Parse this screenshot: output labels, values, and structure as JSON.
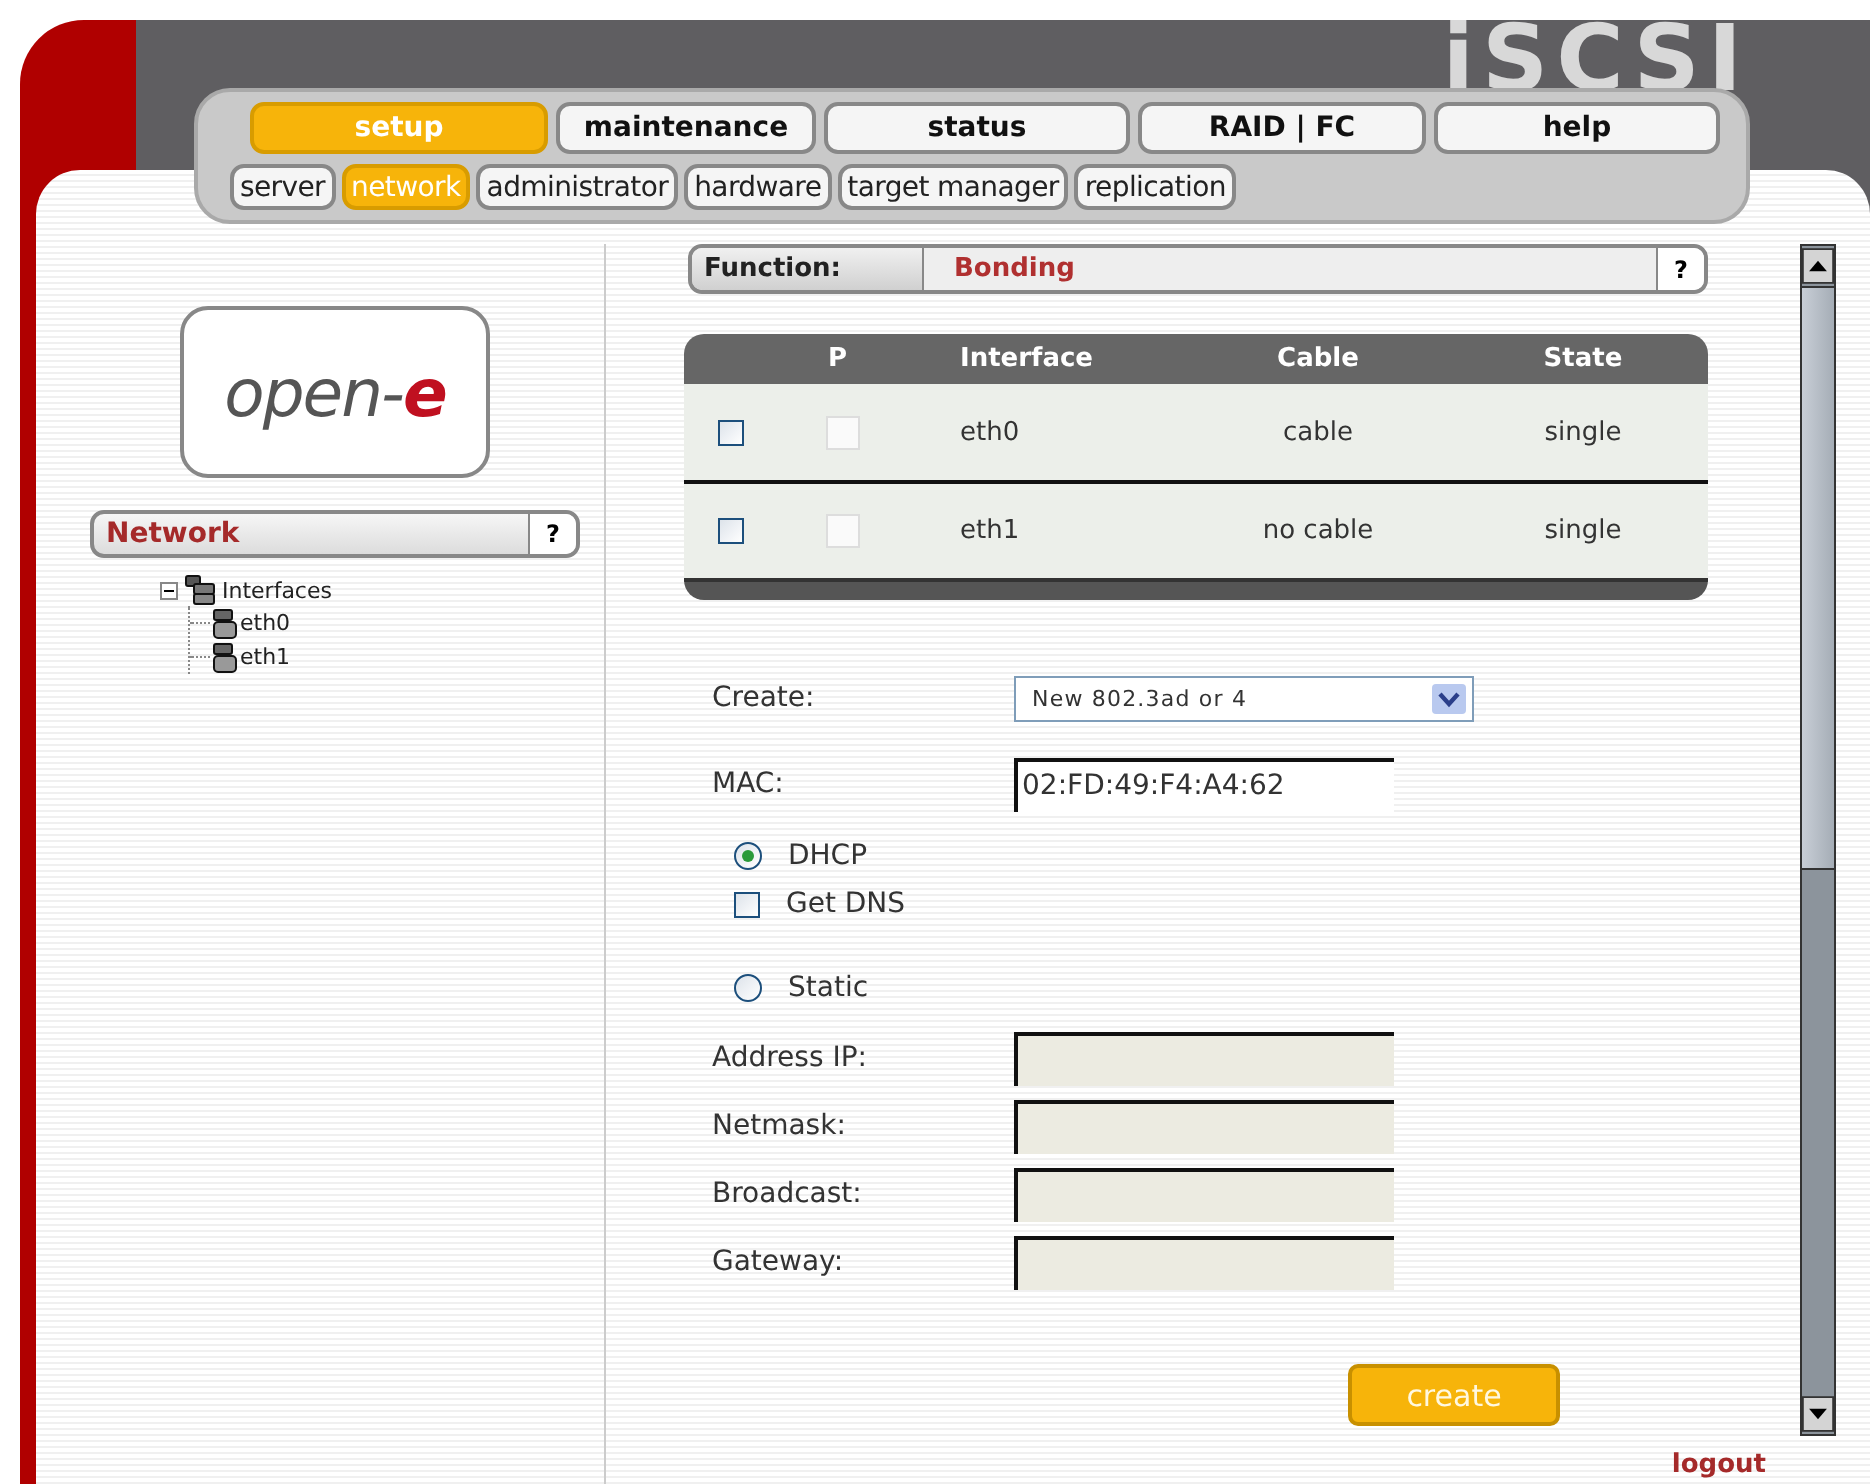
{
  "brand": "iSCSI",
  "main_tabs": [
    {
      "label": "setup",
      "selected": true
    },
    {
      "label": "maintenance",
      "selected": false
    },
    {
      "label": "status",
      "selected": false
    },
    {
      "label": "RAID | FC",
      "selected": false
    },
    {
      "label": "help",
      "selected": false
    }
  ],
  "sub_tabs": [
    {
      "label": "server",
      "selected": false
    },
    {
      "label": "network",
      "selected": true
    },
    {
      "label": "administrator",
      "selected": false
    },
    {
      "label": "hardware",
      "selected": false
    },
    {
      "label": "target manager",
      "selected": false
    },
    {
      "label": "replication",
      "selected": false
    }
  ],
  "logo": {
    "text": "open-",
    "accent": "e"
  },
  "sidebar": {
    "title": "Network",
    "help": "?",
    "tree": [
      {
        "label": "Interfaces",
        "expanded": true,
        "children": [
          {
            "label": "eth0"
          },
          {
            "label": "eth1"
          }
        ]
      }
    ]
  },
  "function_bar": {
    "label": "Function:",
    "value": "Bonding",
    "help": "?"
  },
  "table": {
    "columns": [
      "P",
      "Interface",
      "Cable",
      "State"
    ],
    "rows": [
      {
        "checked": false,
        "p_disabled": true,
        "interface": "eth0",
        "cable": "cable",
        "state": "single"
      },
      {
        "checked": false,
        "p_disabled": true,
        "interface": "eth1",
        "cable": "no cable",
        "state": "single"
      }
    ]
  },
  "form": {
    "create": {
      "label": "Create:",
      "value": "New 802.3ad or 4"
    },
    "mac": {
      "label": "MAC:",
      "value": "02:FD:49:F4:A4:62"
    },
    "dhcp": {
      "label": "DHCP",
      "selected": true
    },
    "get_dns": {
      "label": "Get DNS",
      "checked": false
    },
    "static": {
      "label": "Static",
      "selected": false
    },
    "fields": [
      {
        "label": "Address IP:",
        "disabled": true
      },
      {
        "label": "Netmask:",
        "disabled": true
      },
      {
        "label": "Broadcast:",
        "disabled": true
      },
      {
        "label": "Gateway:",
        "disabled": true
      }
    ]
  },
  "create_button": "create",
  "logout": "logout"
}
